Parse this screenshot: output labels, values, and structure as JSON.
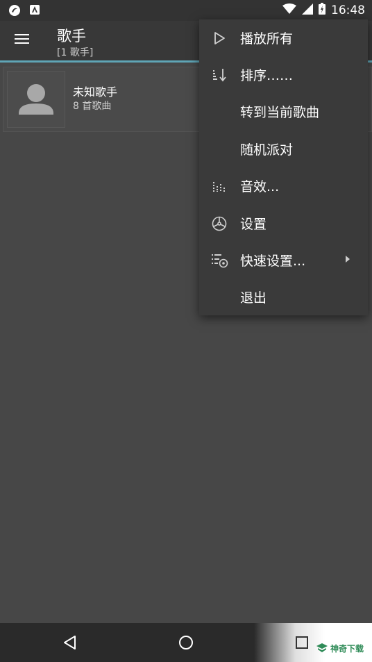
{
  "status_bar": {
    "time": "16:48"
  },
  "app_bar": {
    "title": "歌手",
    "subtitle": "[1 歌手]"
  },
  "artists": [
    {
      "name": "未知歌手",
      "count": "8 首歌曲"
    }
  ],
  "menu": {
    "items": [
      {
        "label": "播放所有",
        "icon": "play-icon"
      },
      {
        "label": "排序……",
        "icon": "sort-icon"
      },
      {
        "label": "转到当前歌曲",
        "icon": ""
      },
      {
        "label": "随机派对",
        "icon": ""
      },
      {
        "label": "音效...",
        "icon": "equalizer-icon"
      },
      {
        "label": "设置",
        "icon": "settings-icon"
      },
      {
        "label": "快速设置...",
        "icon": "quick-settings-icon",
        "has_submenu": true
      },
      {
        "label": "退出",
        "icon": ""
      }
    ]
  },
  "watermark": {
    "text": "神奇下载"
  },
  "colors": {
    "accent": "#5fa5b6",
    "background": "#474747",
    "menu_background": "#3a3a3a"
  }
}
